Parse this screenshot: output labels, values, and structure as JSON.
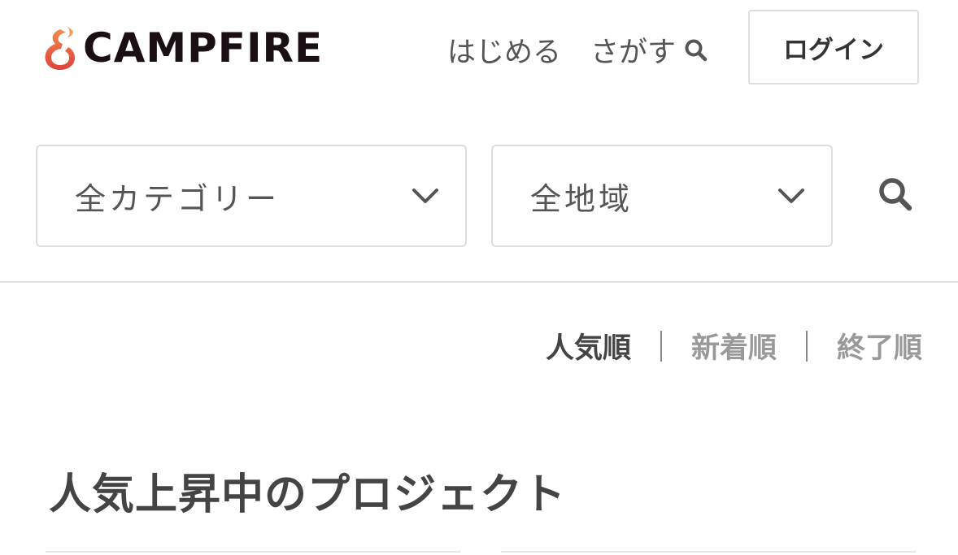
{
  "header": {
    "logo_text": "CAMPFIRE",
    "brand_color": "#e8533f",
    "nav": {
      "start_label": "はじめる",
      "search_label": "さがす"
    },
    "login_label": "ログイン"
  },
  "filters": {
    "category": {
      "selected": "全カテゴリー"
    },
    "area": {
      "selected": "全地域"
    },
    "search_icon": "search-icon"
  },
  "sort": {
    "items": [
      {
        "label": "人気順",
        "active": true
      },
      {
        "label": "新着順",
        "active": false
      },
      {
        "label": "終了順",
        "active": false
      }
    ]
  },
  "section": {
    "title": "人気上昇中のプロジェクト"
  }
}
